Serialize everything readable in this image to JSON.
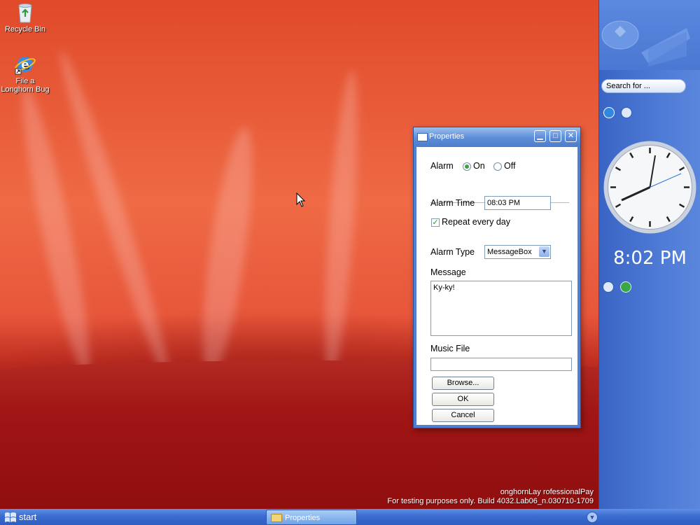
{
  "desktop": {
    "icons": [
      {
        "label": "Recycle Bin",
        "icon": "recycle-bin-icon"
      },
      {
        "label": "File a Longhorn Bug",
        "icon": "internet-explorer-icon"
      }
    ],
    "watermark": {
      "line1": "onghornLay rofessionalPay",
      "line2": "For testing purposes only. Build 4032.Lab06_n.030710-1709"
    }
  },
  "window": {
    "title": "Properties",
    "alarm_label": "Alarm",
    "alarm_on_label": "On",
    "alarm_off_label": "Off",
    "alarm_selected": "On",
    "alarm_time_label": "Alarm Time",
    "alarm_time_value": "08:03 PM",
    "repeat_label": "Repeat every day",
    "repeat_checked": true,
    "alarm_type_label": "Alarm Type",
    "alarm_type_value": "MessageBox",
    "message_label": "Message",
    "message_value": "Ky-ky!",
    "music_file_label": "Music File",
    "music_file_value": "",
    "browse_label": "Browse...",
    "ok_label": "OK",
    "cancel_label": "Cancel"
  },
  "sidebar": {
    "search_placeholder": "Search for ...",
    "time": "8:02 PM"
  },
  "taskbar": {
    "start_label": "start",
    "task_label": "Properties"
  },
  "colors": {
    "taskbar": "#3b6cd0",
    "sidebar": "#4e7bd6",
    "desktop_red": "#e04a2a",
    "title_blue": "#5f8fd8"
  }
}
